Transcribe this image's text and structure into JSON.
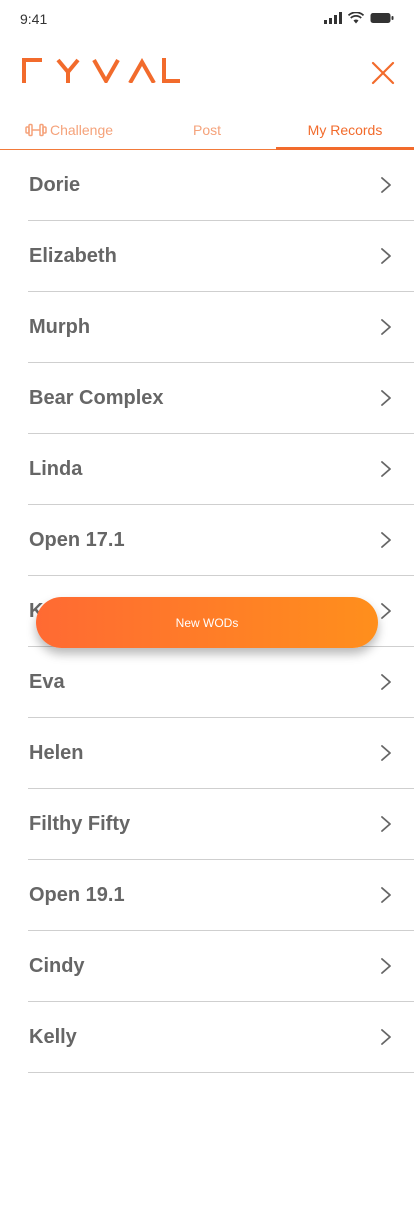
{
  "status_bar": {
    "time": "9:41"
  },
  "brand": {
    "logo_text": "RYVAL",
    "accent_color": "#f26b2c"
  },
  "tabs": [
    {
      "label": "Challenge",
      "icon": "dumbbell-icon",
      "active": false
    },
    {
      "label": "Post",
      "active": false
    },
    {
      "label": "My Records",
      "active": true
    }
  ],
  "wods": [
    {
      "name": "Dorie"
    },
    {
      "name": "Elizabeth"
    },
    {
      "name": "Murph"
    },
    {
      "name": "Bear Complex"
    },
    {
      "name": "Linda"
    },
    {
      "name": "Open 17.1"
    },
    {
      "name": "Karen"
    },
    {
      "name": "Eva"
    },
    {
      "name": "Helen"
    },
    {
      "name": "Filthy Fifty"
    },
    {
      "name": "Open 19.1"
    },
    {
      "name": "Cindy"
    },
    {
      "name": "Kelly"
    }
  ],
  "fab": {
    "label": "New WODs"
  }
}
